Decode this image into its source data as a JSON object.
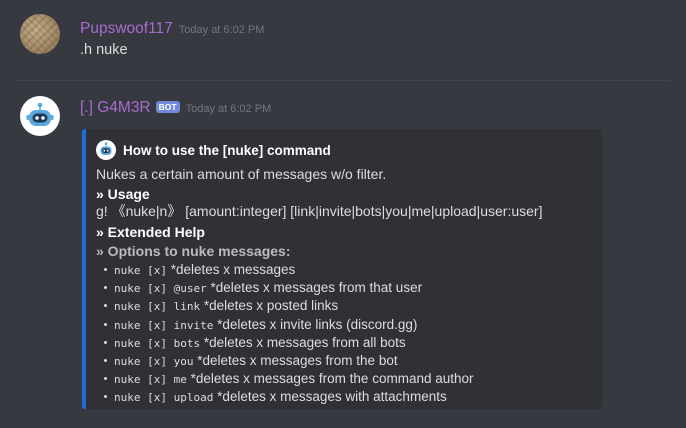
{
  "messages": [
    {
      "username": "Pupswoof117",
      "timestamp": "Today at 6:02 PM",
      "content": ".h nuke"
    },
    {
      "username": "[.] G4M3R",
      "bot_tag": "BOT",
      "timestamp": "Today at 6:02 PM",
      "embed": {
        "author": "How to use the [nuke] command",
        "description": "Nukes a certain amount of messages w/o filter.",
        "usage_title": "» Usage",
        "usage_text": "g! 《nuke|n》 [amount:integer] [link|invite|bots|you|me|upload|user:user]",
        "extended_title": "» Extended Help",
        "options_title": "» Options to nuke messages:",
        "options": [
          {
            "code": "nuke [x]",
            "text": " *deletes x messages"
          },
          {
            "code": "nuke [x] @user",
            "text": " *deletes x messages from that user"
          },
          {
            "code": "nuke [x] link",
            "text": " *deletes x posted links"
          },
          {
            "code": "nuke [x] invite",
            "text": " *deletes x invite links (discord.gg)"
          },
          {
            "code": "nuke [x] bots",
            "text": " *deletes x messages from all bots"
          },
          {
            "code": "nuke [x] you",
            "text": " *deletes x messages from the bot"
          },
          {
            "code": "nuke [x] me",
            "text": " *deletes x messages from the command author"
          },
          {
            "code": "nuke [x] upload",
            "text": " *deletes x messages with attachments"
          }
        ],
        "accent_color": "#1e6ed6"
      }
    }
  ],
  "colors": {
    "background": "#36393f",
    "username": "#a96bd0",
    "bot_tag": "#7289da"
  }
}
